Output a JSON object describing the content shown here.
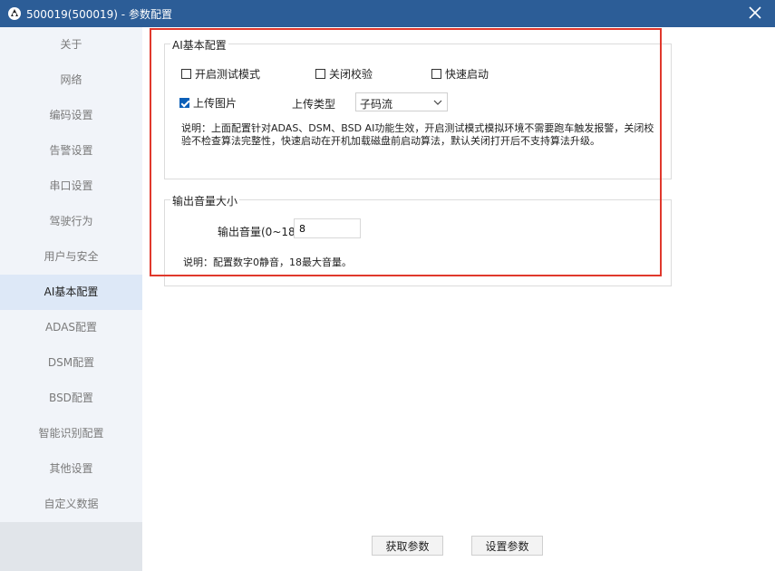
{
  "window": {
    "title": "500019(500019) - 参数配置"
  },
  "sidebar": {
    "items": [
      {
        "label": "关于"
      },
      {
        "label": "网络"
      },
      {
        "label": "编码设置"
      },
      {
        "label": "告警设置"
      },
      {
        "label": "串口设置"
      },
      {
        "label": "驾驶行为"
      },
      {
        "label": "用户与安全"
      },
      {
        "label": "AI基本配置"
      },
      {
        "label": "ADAS配置"
      },
      {
        "label": "DSM配置"
      },
      {
        "label": "BSD配置"
      },
      {
        "label": "智能识别配置"
      },
      {
        "label": "其他设置"
      },
      {
        "label": "自定义数据"
      }
    ],
    "active_index": 7
  },
  "ai_basic": {
    "legend": "AI基本配置",
    "test_mode_label": "开启测试模式",
    "disable_check_label": "关闭校验",
    "fast_start_label": "快速启动",
    "upload_image_label": "上传图片",
    "upload_type_label": "上传类型",
    "upload_type_value": "子码流",
    "description": "说明：上面配置针对ADAS、DSM、BSD AI功能生效，开启测试模式模拟环境不需要跑车触发报警，关闭校验不检查算法完整性，快速启动在开机加载磁盘前启动算法，默认关闭打开后不支持算法升级。"
  },
  "volume": {
    "legend": "输出音量大小",
    "label": "输出音量(0~18)：",
    "value": "8",
    "description": "说明：配置数字0静音，18最大音量。"
  },
  "buttons": {
    "get_params": "获取参数",
    "set_params": "设置参数"
  },
  "colors": {
    "titlebar": "#2c5d97",
    "highlight_border": "#e0382c",
    "checkbox_checked": "#0b5fb8",
    "sidebar_bg": "#f1f4f9",
    "sidebar_active_bg": "#dde8f7"
  }
}
